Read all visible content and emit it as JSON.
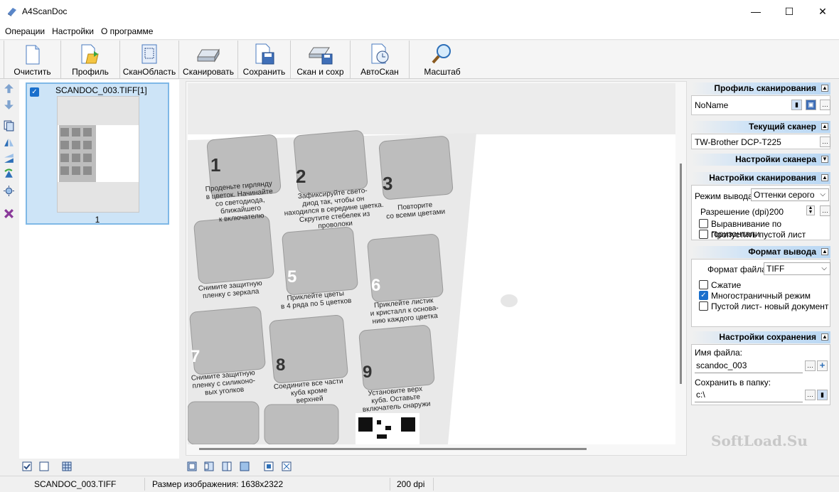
{
  "window": {
    "title": "A4ScanDoc",
    "minimize": "—",
    "maximize": "☐",
    "close": "✕"
  },
  "menu": [
    "Операции",
    "Настройки",
    "О программе"
  ],
  "toolbar": {
    "clear": "Очистить",
    "profile": "Профиль",
    "scan_area": "СканОбласть",
    "scan": "Сканировать",
    "save": "Сохранить",
    "scan_save": "Скан и сохр",
    "autoscan": "АвтоСкан",
    "zoom": "Масштаб"
  },
  "thumbnail": {
    "name": "SCANDOC_003.TIFF[1]",
    "number": "1",
    "checked": true
  },
  "scan_profile": {
    "header": "Профиль сканирования",
    "value": "NoName"
  },
  "current_scanner": {
    "header": "Текущий сканер",
    "value": "TW-Brother DCP-T225"
  },
  "scanner_settings": {
    "header": "Настройки сканера"
  },
  "scan_settings": {
    "header": "Настройки сканирования",
    "output_mode_label": "Режим вывода:",
    "output_mode_value": "Оттенки серого",
    "resolution_label": "Разрешение (dpi):",
    "resolution_value": "200",
    "deskew_label": "Выравнивание по горизонтали",
    "skip_blank_label": "Пропустить пустой лист"
  },
  "output_format": {
    "header": "Формат вывода",
    "file_format_label": "Формат файла:",
    "file_format_value": "TIFF",
    "compression_label": "Сжатие",
    "multipage_label": "Многостраничный режим",
    "blank_new_doc_label": "Пустой лист- новый документ"
  },
  "save_settings": {
    "header": "Настройки сохранения",
    "filename_label": "Имя файла:",
    "filename_value": "scandoc_003",
    "folder_label": "Сохранить в папку:",
    "folder_value": "c:\\"
  },
  "status": {
    "file": "SCANDOC_003.TIFF",
    "size": "Размер изображения: 1638x2322",
    "dpi": "200 dpi"
  },
  "document_text": {
    "step1": "Проденьте гирлянду в цветок. Начинайте со светодиода, ближайшего к включателю",
    "step2": "Зафиксируйте свето-диод так, чтобы он находился в середине цветка. Скрутите стебелек из проволоки",
    "step3": "Повторите со всеми цветами",
    "step4": "Снимите защитную пленку с зеркала",
    "step5": "Приклейте цветы в 4 ряда по 5 цветков",
    "step6": "Приклейте листик и кристалл к основа-нию каждого цветка",
    "step7": "Снимите защитную пленку с силиконо-вых уголков",
    "step8": "Соедините все части куба кроме верхней",
    "step9": "Установите верх куба. Оставьте включатель снаружи"
  },
  "watermark": "SoftLoad.Su"
}
